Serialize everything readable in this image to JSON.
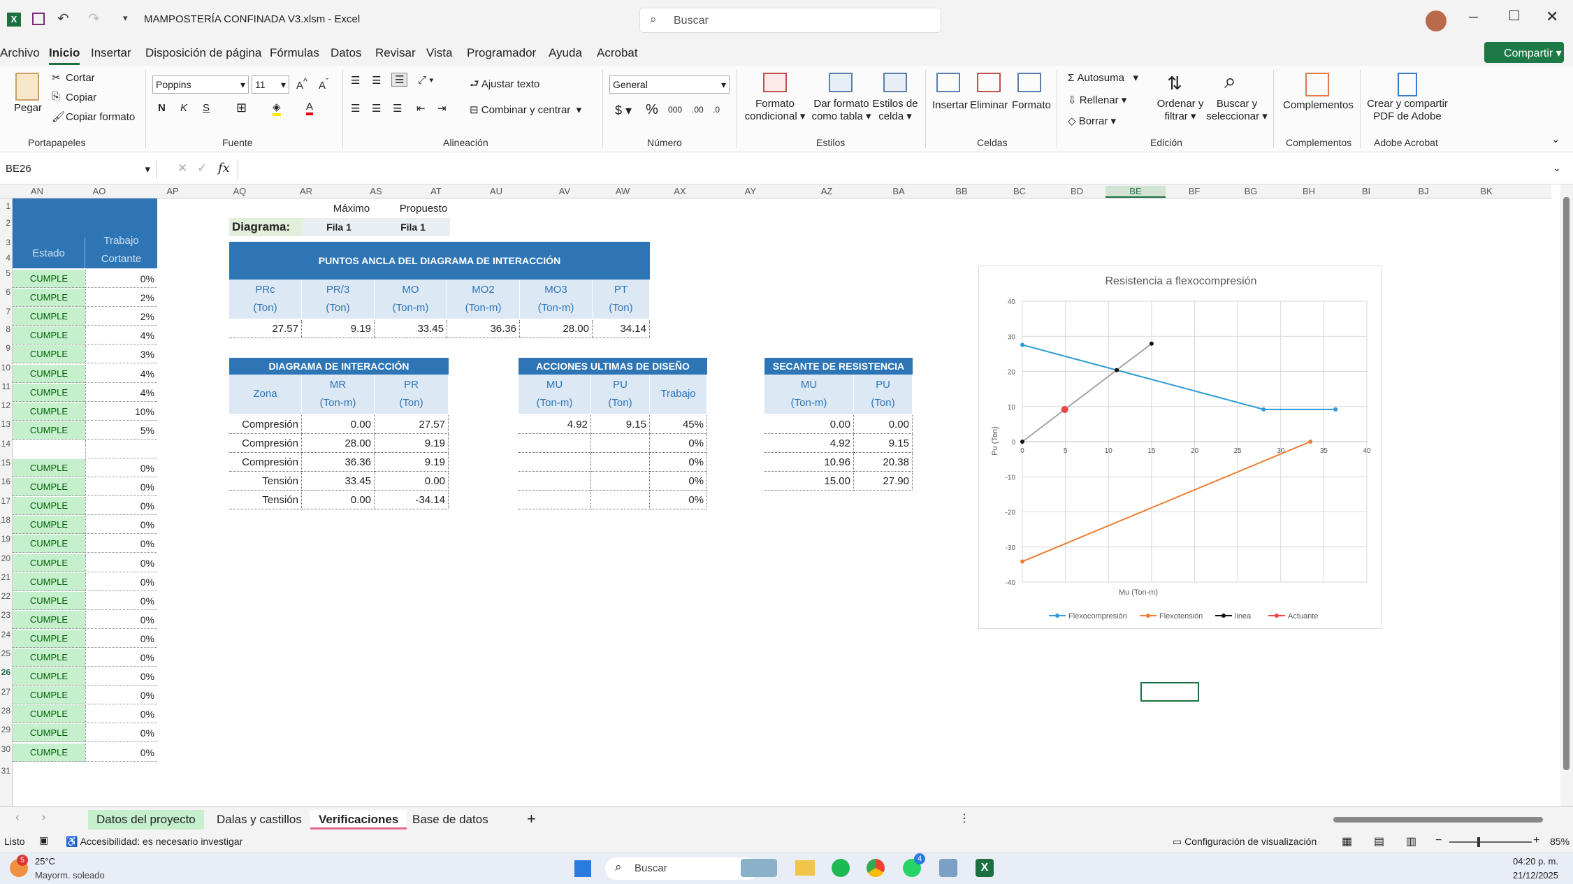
{
  "titlebar": {
    "filename": "MAMPOSTERÍA CONFINADA V3.xlsm  -  Excel",
    "search_placeholder": "Buscar"
  },
  "menu": [
    "Archivo",
    "Inicio",
    "Insertar",
    "Disposición de página",
    "Fórmulas",
    "Datos",
    "Revisar",
    "Vista",
    "Programador",
    "Ayuda",
    "Acrobat"
  ],
  "share_label": "Compartir",
  "ribbon": {
    "paste": "Pegar",
    "cut": "Cortar",
    "copy": "Copiar",
    "copy_format": "Copiar formato",
    "g_clip": "Portapapeles",
    "font_name": "Poppins",
    "font_size": "11",
    "g_font": "Fuente",
    "wrap": "Ajustar texto",
    "merge": "Combinar y centrar",
    "g_align": "Alineación",
    "numfmt": "General",
    "g_num": "Número",
    "cond": "Formato condicional",
    "astable": "Dar formato como tabla",
    "cellstyles": "Estilos de celda",
    "g_styles": "Estilos",
    "insert": "Insertar",
    "delete": "Eliminar",
    "format": "Formato",
    "g_cells": "Celdas",
    "autosum": "Autosuma",
    "fill": "Rellenar",
    "clear": "Borrar",
    "sort": "Ordenar y filtrar",
    "find": "Buscar y seleccionar",
    "g_edit": "Edición",
    "addins": "Complementos",
    "g_addins": "Complementos",
    "pdf": "Crear y compartir PDF de Adobe",
    "g_acrobat": "Adobe Acrobat"
  },
  "namebox": "BE26",
  "columns": [
    "AN",
    "AO",
    "AP",
    "AQ",
    "AR",
    "AS",
    "AT",
    "AU",
    "AV",
    "AW",
    "AX",
    "AY",
    "AZ",
    "BA",
    "BB",
    "BC",
    "BD",
    "BE",
    "BF",
    "BG",
    "BH",
    "BI",
    "BJ",
    "BK"
  ],
  "rows": [
    "1",
    "2",
    "3",
    "4",
    "5",
    "6",
    "7",
    "8",
    "9",
    "10",
    "11",
    "12",
    "13",
    "14",
    "15",
    "16",
    "17",
    "18",
    "19",
    "20",
    "21",
    "22",
    "23",
    "24",
    "25",
    "26",
    "27",
    "28",
    "29",
    "30",
    "31"
  ],
  "estado": {
    "h1": "Estado",
    "h2": "Trabajo",
    "h3": "Cortante",
    "items": [
      [
        "CUMPLE",
        "0%"
      ],
      [
        "CUMPLE",
        "2%"
      ],
      [
        "CUMPLE",
        "2%"
      ],
      [
        "CUMPLE",
        "4%"
      ],
      [
        "CUMPLE",
        "3%"
      ],
      [
        "CUMPLE",
        "4%"
      ],
      [
        "CUMPLE",
        "4%"
      ],
      [
        "CUMPLE",
        "10%"
      ],
      [
        "CUMPLE",
        "5%"
      ],
      [
        "",
        ""
      ],
      [
        "CUMPLE",
        "0%"
      ],
      [
        "CUMPLE",
        "0%"
      ],
      [
        "CUMPLE",
        "0%"
      ],
      [
        "CUMPLE",
        "0%"
      ],
      [
        "CUMPLE",
        "0%"
      ],
      [
        "CUMPLE",
        "0%"
      ],
      [
        "CUMPLE",
        "0%"
      ],
      [
        "CUMPLE",
        "0%"
      ],
      [
        "CUMPLE",
        "0%"
      ],
      [
        "CUMPLE",
        "0%"
      ],
      [
        "CUMPLE",
        "0%"
      ],
      [
        "CUMPLE",
        "0%"
      ],
      [
        "CUMPLE",
        "0%"
      ],
      [
        "CUMPLE",
        "0%"
      ],
      [
        "CUMPLE",
        "0%"
      ],
      [
        "CUMPLE",
        "0%"
      ]
    ]
  },
  "diagram_sel": {
    "maximo": "Máximo",
    "propuesto": "Propuesto",
    "label": "Diagrama:",
    "v1": "Fila 1",
    "v2": "Fila 1"
  },
  "puntos": {
    "title": "PUNTOS ANCLA DEL DIAGRAMA DE INTERACCIÓN",
    "heads": [
      [
        "PRc",
        "(Ton)"
      ],
      [
        "PR/3",
        "(Ton)"
      ],
      [
        "MO",
        "(Ton-m)"
      ],
      [
        "MO2",
        "(Ton-m)"
      ],
      [
        "MO3",
        "(Ton-m)"
      ],
      [
        "PT",
        "(Ton)"
      ]
    ],
    "values": [
      "27.57",
      "9.19",
      "33.45",
      "36.36",
      "28.00",
      "34.14"
    ]
  },
  "diagrama": {
    "title": "DIAGRAMA DE INTERACCIÓN",
    "heads": [
      [
        "Zona",
        ""
      ],
      [
        "MR",
        "(Ton-m)"
      ],
      [
        "PR",
        "(Ton)"
      ]
    ],
    "rows": [
      [
        "Compresión",
        "0.00",
        "27.57"
      ],
      [
        "Compresión",
        "28.00",
        "9.19"
      ],
      [
        "Compresión",
        "36.36",
        "9.19"
      ],
      [
        "Tensión",
        "33.45",
        "0.00"
      ],
      [
        "Tensión",
        "0.00",
        "-34.14"
      ]
    ]
  },
  "acciones": {
    "title": "ACCIONES ULTIMAS DE DISEÑO",
    "heads": [
      [
        "MU",
        "(Ton-m)"
      ],
      [
        "PU",
        "(Ton)"
      ],
      [
        "Trabajo",
        ""
      ]
    ],
    "rows": [
      [
        "4.92",
        "9.15",
        "45%"
      ],
      [
        "",
        "",
        "0%"
      ],
      [
        "",
        "",
        "0%"
      ],
      [
        "",
        "",
        "0%"
      ],
      [
        "",
        "",
        "0%"
      ]
    ]
  },
  "secante": {
    "title": "SECANTE DE RESISTENCIA",
    "heads": [
      [
        "MU",
        "(Ton-m)"
      ],
      [
        "PU",
        "(Ton)"
      ]
    ],
    "rows": [
      [
        "0.00",
        "0.00"
      ],
      [
        "4.92",
        "9.15"
      ],
      [
        "10.96",
        "20.38"
      ],
      [
        "15.00",
        "27.90"
      ]
    ]
  },
  "chart_data": {
    "type": "scatter",
    "title": "Resistencia a flexocompresión",
    "xlabel": "Mu (Ton-m)",
    "ylabel": "Pu (Ton)",
    "xlim": [
      0,
      40
    ],
    "ylim": [
      -40,
      40
    ],
    "xticks": [
      0,
      5,
      10,
      15,
      20,
      25,
      30,
      35,
      40
    ],
    "yticks": [
      -40,
      -30,
      -20,
      -10,
      0,
      10,
      20,
      30,
      40
    ],
    "grid": true,
    "legend": "bottom",
    "series": [
      {
        "name": "Flexocompresión",
        "color": "#2e9bd6",
        "x": [
          0,
          28,
          36.36,
          36.36
        ],
        "y": [
          27.57,
          9.19,
          9.19,
          9.19
        ]
      },
      {
        "name": "Flexotensión",
        "color": "#ed7d31",
        "x": [
          0,
          33.45
        ],
        "y": [
          -34.14,
          0
        ]
      },
      {
        "name": "linea",
        "color": "#111111",
        "x": [
          0,
          10.96,
          15
        ],
        "y": [
          0,
          20.38,
          27.9
        ]
      },
      {
        "name": "Actuante",
        "color": "#ee4444",
        "x": [
          4.92
        ],
        "y": [
          9.15
        ]
      }
    ]
  },
  "sheet_tabs": [
    "Datos del proyecto",
    "Dalas y castillos",
    "Verificaciones",
    "Base de datos"
  ],
  "status": {
    "ready": "Listo",
    "access": "Accesibilidad: es necesario investigar",
    "display": "Configuración de visualización",
    "zoom": "85%"
  },
  "taskbar": {
    "temp": "25°C",
    "weather": "Mayorm. soleado",
    "search": "Buscar",
    "time": "04:20 p. m.",
    "date": "21/12/2025",
    "badge1": "5",
    "badge2": "4"
  }
}
